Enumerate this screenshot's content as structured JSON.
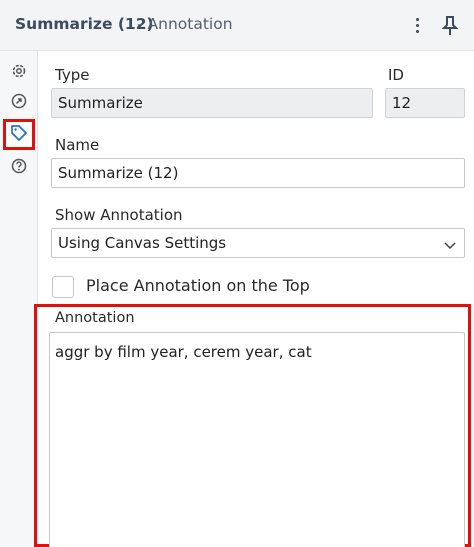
{
  "header": {
    "title": "Summarize (12)",
    "subtitle": "- Annotation",
    "more_icon": "kebab-icon",
    "pin_icon": "pin-icon"
  },
  "rail": {
    "items": [
      {
        "icon": "gear-icon",
        "active": false
      },
      {
        "icon": "connection-arrow-icon",
        "active": false
      },
      {
        "icon": "tag-icon",
        "active": true
      },
      {
        "icon": "help-icon",
        "active": false
      }
    ]
  },
  "form": {
    "type_label": "Type",
    "type_value": "Summarize",
    "id_label": "ID",
    "id_value": "12",
    "name_label": "Name",
    "name_value": "Summarize (12)",
    "show_annotation_label": "Show Annotation",
    "show_annotation_value": "Using Canvas Settings",
    "place_top_label": "Place Annotation on the Top",
    "place_top_checked": false,
    "annotation_label": "Annotation",
    "annotation_value": "aggr by film year, cerem year, cat"
  },
  "colors": {
    "highlight": "#e01010",
    "accent_icon": "#1f6fd1"
  }
}
